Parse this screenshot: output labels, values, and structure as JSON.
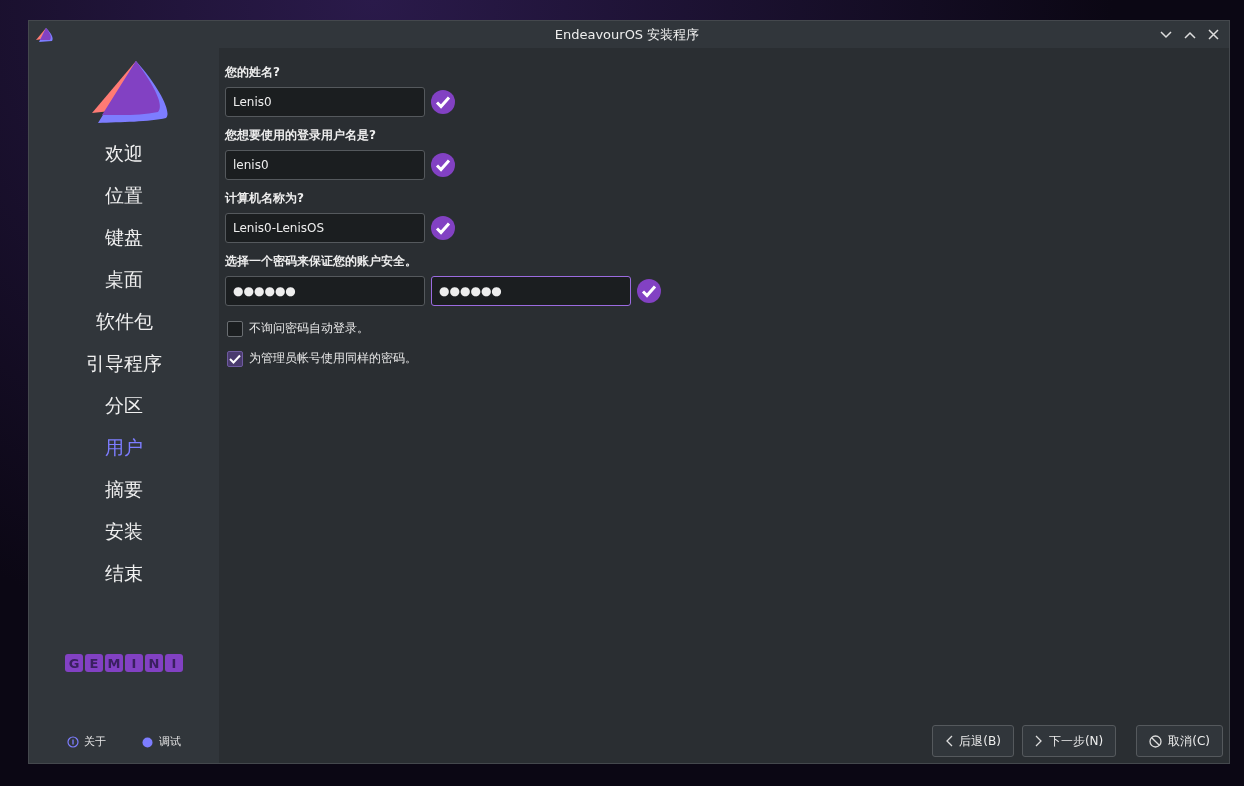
{
  "window": {
    "title": "EndeavourOS 安装程序"
  },
  "sidebar": {
    "steps": [
      {
        "label": "欢迎",
        "selected": false
      },
      {
        "label": "位置",
        "selected": false
      },
      {
        "label": "键盘",
        "selected": false
      },
      {
        "label": "桌面",
        "selected": false
      },
      {
        "label": "软件包",
        "selected": false
      },
      {
        "label": "引导程序",
        "selected": false
      },
      {
        "label": "分区",
        "selected": false
      },
      {
        "label": "用户",
        "selected": true
      },
      {
        "label": "摘要",
        "selected": false
      },
      {
        "label": "安装",
        "selected": false
      },
      {
        "label": "结束",
        "selected": false
      }
    ],
    "brand_letters": [
      "G",
      "E",
      "M",
      "I",
      "N",
      "I"
    ],
    "about": "关于",
    "debug": "调试"
  },
  "form": {
    "sections": [
      {
        "label": "您的姓名?",
        "fields": [
          {
            "value": "Lenis0",
            "focused": false
          }
        ],
        "valid": true
      },
      {
        "label": "您想要使用的登录用户名是?",
        "fields": [
          {
            "value": "lenis0",
            "focused": false
          }
        ],
        "valid": true
      },
      {
        "label": "计算机名称为?",
        "fields": [
          {
            "value": "Lenis0-LenisOS",
            "focused": false
          }
        ],
        "valid": true
      },
      {
        "label": "选择一个密码来保证您的账户安全。",
        "fields": [
          {
            "value": "●●●●●●",
            "focused": false
          },
          {
            "value": "●●●●●●",
            "focused": true
          }
        ],
        "valid": true
      }
    ],
    "options": [
      {
        "label": "不询问密码自动登录。",
        "checked": false
      },
      {
        "label": "为管理员帐号使用同样的密码。",
        "checked": true
      }
    ]
  },
  "buttons": [
    {
      "kind": "back",
      "label": "后退(B)"
    },
    {
      "kind": "next",
      "label": "下一步(N)"
    },
    {
      "kind": "cancel",
      "label": "取消(C)"
    }
  ]
}
